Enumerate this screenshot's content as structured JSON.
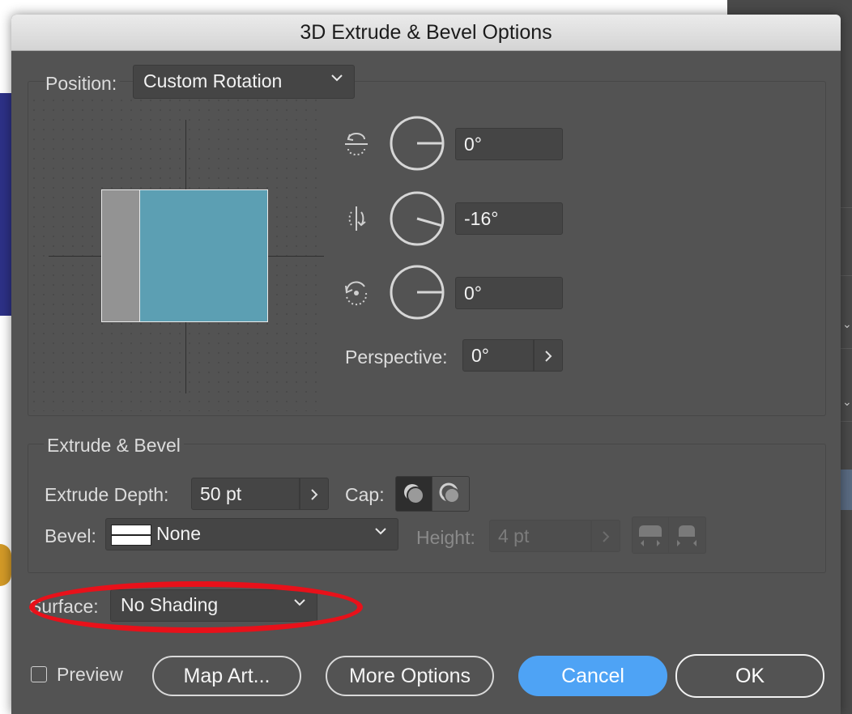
{
  "dialog": {
    "title": "3D Extrude & Bevel Options"
  },
  "position": {
    "label": "Position:",
    "value": "Custom Rotation",
    "x_rotation": "0°",
    "y_rotation": "-16°",
    "z_rotation": "0°",
    "perspective_label": "Perspective:",
    "perspective_value": "0°"
  },
  "extrude": {
    "section_label": "Extrude & Bevel",
    "depth_label": "Extrude Depth:",
    "depth_value": "50 pt",
    "cap_label": "Cap:",
    "bevel_label": "Bevel:",
    "bevel_value": "None",
    "height_label": "Height:",
    "height_value": "4 pt"
  },
  "surface": {
    "label": "Surface:",
    "value": "No Shading"
  },
  "footer": {
    "preview_label": "Preview",
    "preview_checked": false,
    "map_art": "Map Art...",
    "more_options": "More Options",
    "cancel": "Cancel",
    "ok": "OK"
  },
  "colors": {
    "dialog_bg": "#535353",
    "cube_front": "#5c9fb3",
    "cube_side": "#939393",
    "primary_button": "#4ea3f5",
    "highlight_oval": "#e8111a"
  },
  "icons": {
    "x_axis": "rotate-x-icon",
    "y_axis": "rotate-y-icon",
    "z_axis": "rotate-z-icon",
    "cap_on": "cap-on-icon",
    "cap_off": "cap-off-icon",
    "bevel_out": "bevel-out-icon",
    "bevel_in": "bevel-in-icon"
  }
}
